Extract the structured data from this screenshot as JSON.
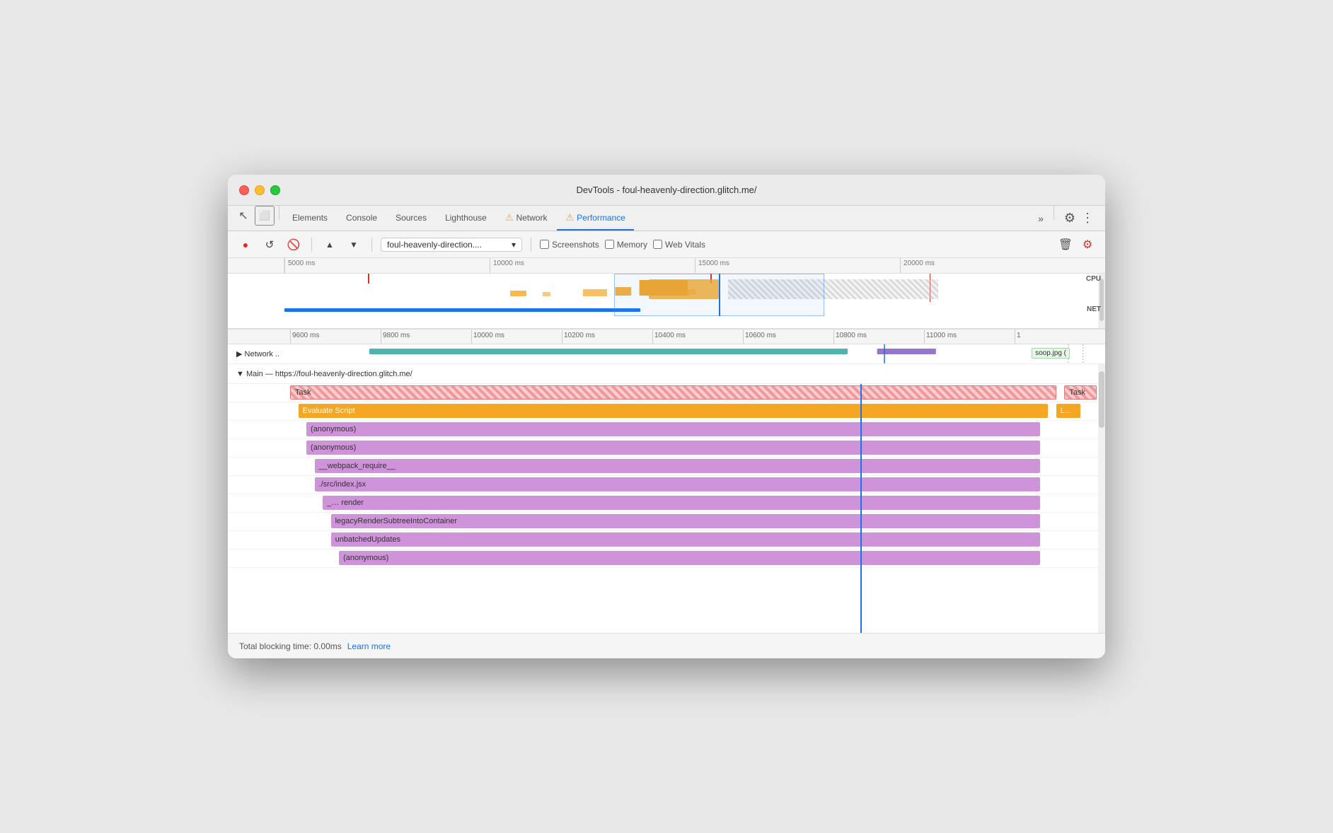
{
  "window": {
    "title": "DevTools - foul-heavenly-direction.glitch.me/"
  },
  "tabs": [
    {
      "label": "Elements",
      "active": false
    },
    {
      "label": "Console",
      "active": false
    },
    {
      "label": "Sources",
      "active": false
    },
    {
      "label": "Lighthouse",
      "active": false
    },
    {
      "label": "Network",
      "active": false,
      "warn": true
    },
    {
      "label": "Performance",
      "active": true,
      "warn": true
    },
    {
      "label": "»",
      "active": false
    }
  ],
  "toolbar": {
    "record_label": "●",
    "reload_label": "↺",
    "clear_label": "🚫",
    "upload_label": "▲",
    "download_label": "▼",
    "url": "foul-heavenly-direction....",
    "screenshots_label": "Screenshots",
    "memory_label": "Memory",
    "webvitals_label": "Web Vitals",
    "settings_label": "⚙",
    "more_label": "⋮"
  },
  "timeline": {
    "overview_ticks": [
      "5000 ms",
      "10000 ms",
      "15000 ms",
      "20000 ms"
    ],
    "zoom_ticks": [
      "9600 ms",
      "9800 ms",
      "10000 ms",
      "10200 ms",
      "10400 ms",
      "10600 ms",
      "10800 ms",
      "11000 ms",
      "1"
    ],
    "cpu_label": "CPU",
    "net_label": "NET"
  },
  "network_row": {
    "label": "▶ Network ..",
    "tag": "soop.jpg ("
  },
  "flame_chart": {
    "main_label": "▼ Main — https://foul-heavenly-direction.glitch.me/",
    "rows": [
      {
        "label": "Task",
        "type": "task",
        "indent": 0
      },
      {
        "label": "Evaluate Script",
        "type": "evaluate",
        "indent": 1
      },
      {
        "label": "(anonymous)",
        "type": "anon",
        "indent": 2
      },
      {
        "label": "(anonymous)",
        "type": "anon",
        "indent": 2
      },
      {
        "label": "__webpack_require__",
        "type": "anon",
        "indent": 3
      },
      {
        "label": "./src/index.jsx",
        "type": "anon",
        "indent": 3
      },
      {
        "label": "_…  render",
        "type": "anon",
        "indent": 4
      },
      {
        "label": "legacyRenderSubtreeIntoContainer",
        "type": "anon",
        "indent": 5
      },
      {
        "label": "unbatchedUpdates",
        "type": "anon",
        "indent": 5
      },
      {
        "label": "(anonymous)",
        "type": "anon",
        "indent": 5
      }
    ],
    "task_label_right": "Task",
    "evaluate_label_right": "L..."
  },
  "statusbar": {
    "text": "Total blocking time: 0.00ms",
    "learn_more": "Learn more"
  }
}
